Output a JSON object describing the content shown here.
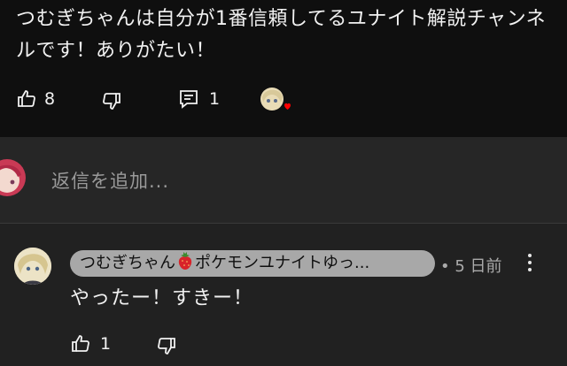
{
  "comment": {
    "text": "つむぎちゃんは自分が1番信頼してるユナイト解説チャンネルです！ありがたい！",
    "like_count": "8",
    "reply_count": "1",
    "icons": [
      "thumbs-up-icon",
      "thumbs-down-icon",
      "comment-icon",
      "creator-heart-icon"
    ]
  },
  "reply_box": {
    "placeholder": "返信を追加..."
  },
  "reply": {
    "author": "つむぎちゃん",
    "author_suffix": "ポケモンユナイトゆっ...",
    "meta": "• 5 日前",
    "text": "やったー！すきー！",
    "like_count": "1"
  },
  "colors": {
    "background": "#212121",
    "top_background": "#0f0f0f",
    "author_chip": "#a8a8a8",
    "heart": "#ff0000"
  }
}
